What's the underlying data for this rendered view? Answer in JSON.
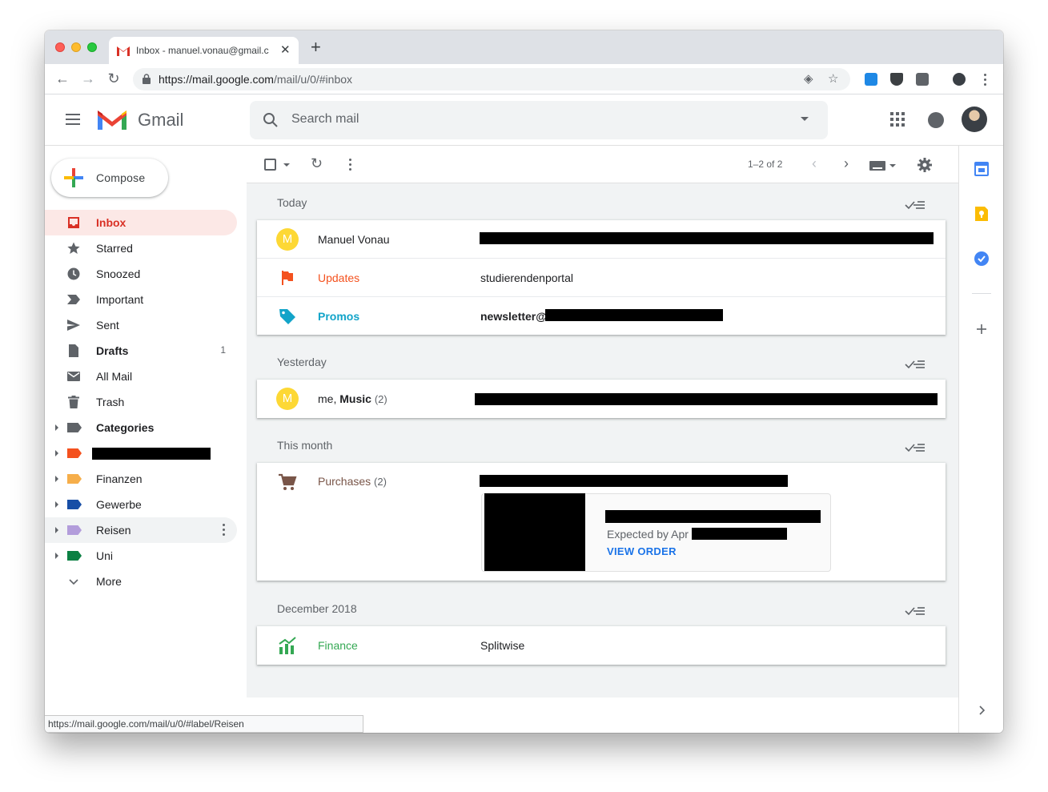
{
  "browser": {
    "tab_title": "Inbox - manuel.vonau@gmail.c",
    "new_tab": "+",
    "close_tab": "✕",
    "url_host": "https://mail.google.com",
    "url_path": "/mail/u/0/#inbox",
    "status_url": "https://mail.google.com/mail/u/0/#label/Reisen"
  },
  "header": {
    "product": "Gmail",
    "search_placeholder": "Search mail"
  },
  "sidebar": {
    "compose": "Compose",
    "items": [
      {
        "label": "Inbox",
        "icon": "inbox-icon",
        "active": true
      },
      {
        "label": "Starred",
        "icon": "star-icon"
      },
      {
        "label": "Snoozed",
        "icon": "clock-icon"
      },
      {
        "label": "Important",
        "icon": "important-icon"
      },
      {
        "label": "Sent",
        "icon": "send-icon"
      },
      {
        "label": "Drafts",
        "icon": "draft-icon",
        "count": "1"
      },
      {
        "label": "All Mail",
        "icon": "mail-icon"
      },
      {
        "label": "Trash",
        "icon": "trash-icon"
      },
      {
        "label": "Categories",
        "icon": "label-icon"
      },
      {
        "label": "",
        "icon": "label-icon",
        "color": "#f4511e"
      },
      {
        "label": "Finanzen",
        "icon": "label-icon",
        "color": "#f6ae4a"
      },
      {
        "label": "Gewerbe",
        "icon": "label-icon",
        "color": "#174ea6"
      },
      {
        "label": "Reisen",
        "icon": "label-icon",
        "color": "#b39ddb"
      },
      {
        "label": "Uni",
        "icon": "label-icon",
        "color": "#0b8043"
      },
      {
        "label": "More",
        "icon": "chevron-down-icon"
      }
    ]
  },
  "toolbar": {
    "pager": "1–2 of 2"
  },
  "sections": [
    {
      "label": "Today",
      "rows": [
        {
          "sender": "Manuel Vonau",
          "avatar": "M",
          "subject": ""
        },
        {
          "sender": "Updates",
          "subject": "studierendenportal",
          "color": "#f4511e"
        },
        {
          "sender": "Promos",
          "subject": "newsletter@",
          "color": "#12a4c9"
        }
      ]
    },
    {
      "label": "Yesterday",
      "rows": [
        {
          "sender_prefix": "me, ",
          "sender": "Music",
          "count": "(2)",
          "avatar": "M"
        }
      ]
    },
    {
      "label": "This month",
      "rows": [
        {
          "sender": "Purchases",
          "count": "(2)",
          "color": "#795548",
          "expected": "Expected by Apr",
          "action": "VIEW ORDER"
        }
      ]
    },
    {
      "label": "December 2018",
      "rows": [
        {
          "sender": "Finance",
          "subject": "Splitwise",
          "color": "#34a853"
        }
      ]
    }
  ],
  "colors": {
    "accent_red": "#d93025",
    "inbox_bg": "#fce8e6",
    "link_blue": "#1a73e8"
  }
}
